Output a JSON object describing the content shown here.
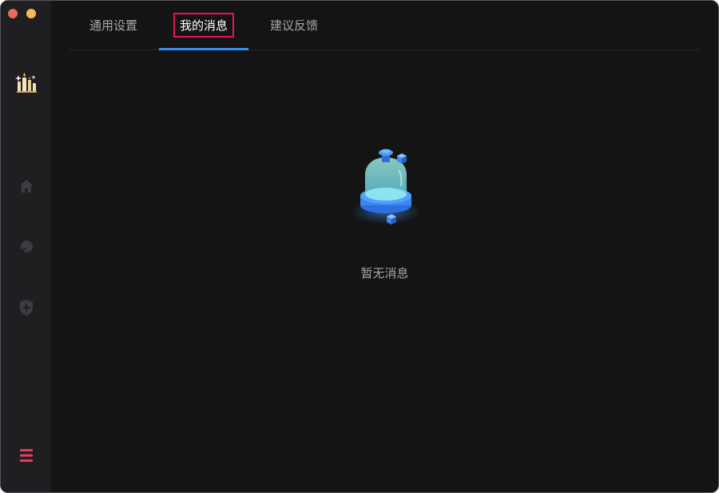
{
  "window": {
    "controls": [
      "close",
      "minimize"
    ],
    "colors": {
      "close": "#ed6a5e",
      "minimize": "#f5bf4f"
    }
  },
  "sidebar": {
    "logo_icon": "candles-icon",
    "items": [
      {
        "icon": "home-icon"
      },
      {
        "icon": "circle-arrow-icon"
      },
      {
        "icon": "shield-plus-icon"
      }
    ],
    "menu_icon": "hamburger-menu-icon",
    "menu_color": "#e23d61"
  },
  "tabs": [
    {
      "label": "通用设置",
      "active": false
    },
    {
      "label": "我的消息",
      "active": true
    },
    {
      "label": "建议反馈",
      "active": false
    }
  ],
  "accent_color": "#3b8ff2",
  "empty_state": {
    "icon": "empty-bell-jar-icon",
    "text": "暂无消息"
  }
}
